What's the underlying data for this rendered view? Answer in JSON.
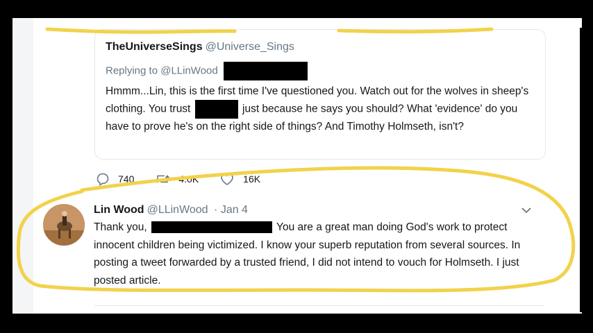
{
  "quoted": {
    "display_name": "TheUniverseSings",
    "handle": "@Universe_Sings",
    "replying_prefix": "Replying to",
    "replying_mention": "@LLinWood",
    "text_part1": "Hmmm...Lin, this is the first time I've questioned you. Watch out for the wolves in sheep's clothing. You trust",
    "text_part2": "just because he says you should? What 'evidence' do you have to prove he's on the right side of things? And Timothy Holmseth, isn't?"
  },
  "actions": {
    "replies": "740",
    "retweets": "4.0K",
    "likes": "16K"
  },
  "reply": {
    "display_name": "Lin Wood",
    "handle": "@LLinWood",
    "separator": "·",
    "date": "Jan 4",
    "text_part1": "Thank you,",
    "text_part2": "You are a great man doing God's work to protect innocent children being victimized. I know your superb reputation from several sources. In posting a tweet forwarded by a trusted friend, I did not intend to vouch for Holmseth. I just posted article."
  },
  "icons": {
    "reply": "speech-bubble-icon",
    "retweet": "retweet-icon",
    "like": "heart-icon",
    "menu": "chevron-down-icon"
  },
  "colors": {
    "highlight": "#f2d24a",
    "secondary_text": "#657786",
    "primary_text": "#14171a",
    "border": "#e4e7ea"
  }
}
